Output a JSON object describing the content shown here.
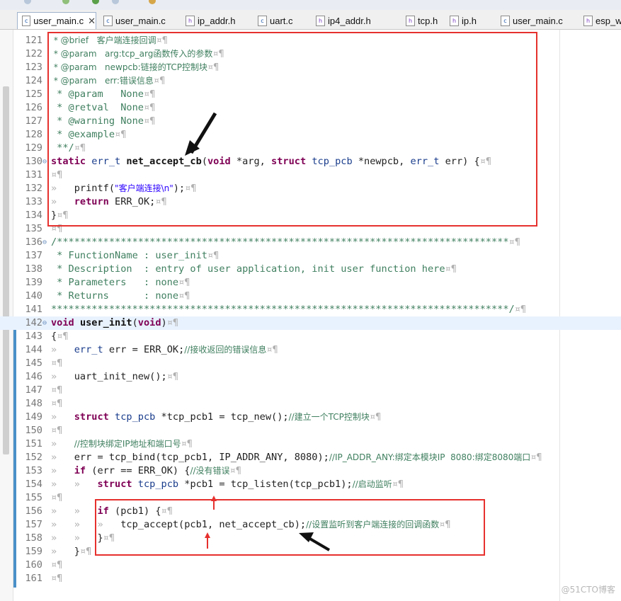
{
  "tabs": [
    {
      "label": "user_main.c",
      "type": "c",
      "active": true,
      "closable": true
    },
    {
      "label": "user_main.c",
      "type": "c",
      "active": false,
      "closable": false
    },
    {
      "label": "ip_addr.h",
      "type": "h",
      "active": false,
      "closable": false
    },
    {
      "label": "uart.c",
      "type": "c",
      "active": false,
      "closable": false
    },
    {
      "label": "ip4_addr.h",
      "type": "h",
      "active": false,
      "closable": false
    },
    {
      "label": "tcp.h",
      "type": "h",
      "active": false,
      "closable": false
    },
    {
      "label": "ip.h",
      "type": "h",
      "active": false,
      "closable": false
    },
    {
      "label": "user_main.c",
      "type": "c",
      "active": false,
      "closable": false
    },
    {
      "label": "esp_wi",
      "type": "h",
      "active": false,
      "closable": false
    }
  ],
  "close_glyph": "✕",
  "lines": [
    {
      "n": "121",
      "t": [
        [
          "c",
          " * @brief   客户端连接回调"
        ],
        [
          "ws",
          "¤¶"
        ]
      ]
    },
    {
      "n": "122",
      "t": [
        [
          "c",
          " * @param   arg:tcp_arg函数传入的参数"
        ],
        [
          "ws",
          "¤¶"
        ]
      ]
    },
    {
      "n": "123",
      "t": [
        [
          "c",
          " * @param   newpcb:链接的TCP控制块"
        ],
        [
          "ws",
          "¤¶"
        ]
      ]
    },
    {
      "n": "124",
      "t": [
        [
          "c",
          " * @param   err:错误信息"
        ],
        [
          "ws",
          "¤¶"
        ]
      ]
    },
    {
      "n": "125",
      "t": [
        [
          "c",
          " * @param   None"
        ],
        [
          "ws",
          "¤¶"
        ]
      ]
    },
    {
      "n": "126",
      "t": [
        [
          "c",
          " * @retval  None"
        ],
        [
          "ws",
          "¤¶"
        ]
      ]
    },
    {
      "n": "127",
      "t": [
        [
          "c",
          " * @warning None"
        ],
        [
          "ws",
          "¤¶"
        ]
      ]
    },
    {
      "n": "128",
      "t": [
        [
          "c",
          " * @example"
        ],
        [
          "ws",
          "¤¶"
        ]
      ]
    },
    {
      "n": "129",
      "t": [
        [
          "c",
          " **/"
        ],
        [
          "ws",
          "¤¶"
        ]
      ]
    },
    {
      "n": "130",
      "fold": true,
      "t": [
        [
          "kw",
          "static"
        ],
        [
          "",
          "",
          " "
        ],
        [
          "ty",
          "err_t"
        ],
        [
          "",
          " "
        ],
        [
          "fn",
          "net_accept_cb"
        ],
        [
          "",
          "("
        ],
        [
          "kw",
          "void"
        ],
        [
          "",
          " *arg, "
        ],
        [
          "kw",
          "struct"
        ],
        [
          "",
          " "
        ],
        [
          "ty",
          "tcp_pcb"
        ],
        [
          "",
          " *newpcb, "
        ],
        [
          "ty",
          "err_t"
        ],
        [
          "",
          " err) {"
        ],
        [
          "ws",
          "¤¶"
        ]
      ]
    },
    {
      "n": "131",
      "t": [
        [
          "ws",
          "¤¶"
        ]
      ]
    },
    {
      "n": "132",
      "t": [
        [
          "ws",
          "»   "
        ],
        [
          "",
          "printf("
        ],
        [
          "st",
          "\"客户端连接\\n\""
        ],
        [
          "",
          ");"
        ],
        [
          "ws",
          "¤¶"
        ]
      ]
    },
    {
      "n": "133",
      "t": [
        [
          "ws",
          "»   "
        ],
        [
          "kw",
          "return"
        ],
        [
          "",
          " ERR_OK;"
        ],
        [
          "ws",
          "¤¶"
        ]
      ]
    },
    {
      "n": "134",
      "t": [
        [
          "",
          "}"
        ],
        [
          "ws",
          "¤¶"
        ]
      ]
    },
    {
      "n": "135",
      "t": [
        [
          "ws",
          "¤¶"
        ]
      ]
    },
    {
      "n": "136",
      "fold": true,
      "t": [
        [
          "c",
          "/******************************************************************************"
        ],
        [
          "ws",
          "¤¶"
        ]
      ]
    },
    {
      "n": "137",
      "t": [
        [
          "c",
          " * FunctionName : user_init"
        ],
        [
          "ws",
          "¤¶"
        ]
      ]
    },
    {
      "n": "138",
      "t": [
        [
          "c",
          " * Description  : entry of user application, init user function here"
        ],
        [
          "ws",
          "¤¶"
        ]
      ]
    },
    {
      "n": "139",
      "t": [
        [
          "c",
          " * Parameters   : none"
        ],
        [
          "ws",
          "¤¶"
        ]
      ]
    },
    {
      "n": "140",
      "t": [
        [
          "c",
          " * Returns      : none"
        ],
        [
          "ws",
          "¤¶"
        ]
      ]
    },
    {
      "n": "141",
      "t": [
        [
          "c",
          "*******************************************************************************/"
        ],
        [
          "ws",
          "¤¶"
        ]
      ]
    },
    {
      "n": "142",
      "fold": true,
      "hl": true,
      "t": [
        [
          "kw",
          "void"
        ],
        [
          "",
          " "
        ],
        [
          "fn",
          "user_init"
        ],
        [
          "",
          "("
        ],
        [
          "kw",
          "void"
        ],
        [
          "",
          ")"
        ],
        [
          "ws",
          "¤¶"
        ]
      ]
    },
    {
      "n": "143",
      "t": [
        [
          "",
          "{"
        ],
        [
          "ws",
          "¤¶"
        ]
      ]
    },
    {
      "n": "144",
      "t": [
        [
          "ws",
          "»   "
        ],
        [
          "ty",
          "err_t"
        ],
        [
          "",
          " err = ERR_OK;"
        ],
        [
          "c",
          "//接收返回的错误信息"
        ],
        [
          "ws",
          "¤¶"
        ]
      ]
    },
    {
      "n": "145",
      "t": [
        [
          "ws",
          "¤¶"
        ]
      ]
    },
    {
      "n": "146",
      "t": [
        [
          "ws",
          "»   "
        ],
        [
          "",
          "uart_init_new();"
        ],
        [
          "ws",
          "¤¶"
        ]
      ]
    },
    {
      "n": "147",
      "t": [
        [
          "ws",
          "¤¶"
        ]
      ]
    },
    {
      "n": "148",
      "t": [
        [
          "ws",
          "¤¶"
        ]
      ]
    },
    {
      "n": "149",
      "t": [
        [
          "ws",
          "»   "
        ],
        [
          "kw",
          "struct"
        ],
        [
          "",
          " "
        ],
        [
          "ty",
          "tcp_pcb"
        ],
        [
          "",
          " *tcp_pcb1 = tcp_new();"
        ],
        [
          "c",
          "//建立一个TCP控制块"
        ],
        [
          "ws",
          "¤¶"
        ]
      ]
    },
    {
      "n": "150",
      "t": [
        [
          "ws",
          "¤¶"
        ]
      ]
    },
    {
      "n": "151",
      "t": [
        [
          "ws",
          "»   "
        ],
        [
          "c",
          "//控制块绑定IP地址和端口号"
        ],
        [
          "ws",
          "¤¶"
        ]
      ]
    },
    {
      "n": "152",
      "t": [
        [
          "ws",
          "»   "
        ],
        [
          "",
          "err = tcp_bind(tcp_pcb1, IP_ADDR_ANY, 8080);"
        ],
        [
          "c",
          "//IP_ADDR_ANY:绑定本模块IP  8080:绑定8080端口"
        ],
        [
          "ws",
          "¤¶"
        ]
      ]
    },
    {
      "n": "153",
      "t": [
        [
          "ws",
          "»   "
        ],
        [
          "kw",
          "if"
        ],
        [
          "",
          " (err == ERR_OK) {"
        ],
        [
          "c",
          "//没有错误"
        ],
        [
          "ws",
          "¤¶"
        ]
      ]
    },
    {
      "n": "154",
      "t": [
        [
          "ws",
          "»   »   "
        ],
        [
          "kw",
          "struct"
        ],
        [
          "",
          " "
        ],
        [
          "ty",
          "tcp_pcb"
        ],
        [
          "",
          " *pcb1 = tcp_listen(tcp_pcb1);"
        ],
        [
          "c",
          "//启动监听"
        ],
        [
          "ws",
          "¤¶"
        ]
      ]
    },
    {
      "n": "155",
      "t": [
        [
          "ws",
          "¤¶"
        ]
      ]
    },
    {
      "n": "156",
      "t": [
        [
          "ws",
          "»   »   "
        ],
        [
          "kw",
          "if"
        ],
        [
          "",
          " (pcb1) {"
        ],
        [
          "ws",
          "¤¶"
        ]
      ]
    },
    {
      "n": "157",
      "t": [
        [
          "ws",
          "»   »   »   "
        ],
        [
          "",
          "tcp_accept(pcb1, net_accept_cb);"
        ],
        [
          "c",
          "//设置监听到客户端连接的回调函数"
        ],
        [
          "ws",
          "¤¶"
        ]
      ]
    },
    {
      "n": "158",
      "t": [
        [
          "ws",
          "»   »   "
        ],
        [
          "",
          "}"
        ],
        [
          "ws",
          "¤¶"
        ]
      ]
    },
    {
      "n": "159",
      "t": [
        [
          "ws",
          "»   "
        ],
        [
          "",
          "}"
        ],
        [
          "ws",
          "¤¶"
        ]
      ]
    },
    {
      "n": "160",
      "t": [
        [
          "ws",
          "¤¶"
        ]
      ]
    },
    {
      "n": "161",
      "t": [
        [
          "ws",
          "¤¶"
        ]
      ]
    }
  ],
  "annotations": {
    "box_color": "#e6312e",
    "arrow_color": "#111111",
    "small_arrow_color": "#e6312e"
  },
  "watermark": "@51CTO博客"
}
